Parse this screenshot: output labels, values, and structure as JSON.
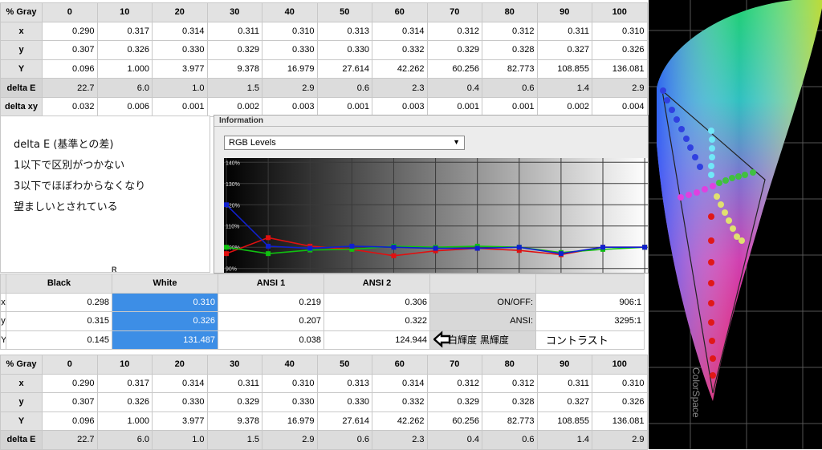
{
  "gray_table": {
    "header": [
      "% Gray",
      "0",
      "10",
      "20",
      "30",
      "40",
      "50",
      "60",
      "70",
      "80",
      "90",
      "100"
    ],
    "rows": [
      {
        "label": "x",
        "values": [
          "0.290",
          "0.317",
          "0.314",
          "0.311",
          "0.310",
          "0.313",
          "0.314",
          "0.312",
          "0.312",
          "0.311",
          "0.310"
        ]
      },
      {
        "label": "y",
        "values": [
          "0.307",
          "0.326",
          "0.330",
          "0.329",
          "0.330",
          "0.330",
          "0.332",
          "0.329",
          "0.328",
          "0.327",
          "0.326"
        ]
      },
      {
        "label": "Y",
        "values": [
          "0.096",
          "1.000",
          "3.977",
          "9.378",
          "16.979",
          "27.614",
          "42.262",
          "60.256",
          "82.773",
          "108.855",
          "136.081"
        ]
      },
      {
        "label": "delta E",
        "values": [
          "22.7",
          "6.0",
          "1.0",
          "1.5",
          "2.9",
          "0.6",
          "2.3",
          "0.4",
          "0.6",
          "1.4",
          "2.9"
        ]
      },
      {
        "label": "delta xy",
        "values": [
          "0.032",
          "0.006",
          "0.001",
          "0.002",
          "0.003",
          "0.001",
          "0.003",
          "0.001",
          "0.001",
          "0.002",
          "0.004"
        ]
      }
    ]
  },
  "note": {
    "lines": [
      "delta E (基準との差)",
      "1以下で区別がつかない",
      "3以下でほぼわからなくなり",
      "望ましいとされている"
    ],
    "fragment": "R"
  },
  "info": {
    "title": "Information",
    "select_value": "RGB Levels",
    "y_ticks": [
      "140%",
      "130%",
      "120%",
      "110%",
      "100%",
      "90%"
    ]
  },
  "chart_data": {
    "type": "line",
    "x": [
      "0",
      "10",
      "20",
      "30",
      "40",
      "50",
      "60",
      "70",
      "80",
      "90",
      "100"
    ],
    "ylim": [
      88,
      142
    ],
    "series": [
      {
        "name": "",
        "color": "#e01010",
        "values": [
          97,
          104.5,
          100.5,
          99,
          96,
          98.3,
          99.5,
          98.5,
          96.5,
          100,
          100
        ]
      },
      {
        "name": "",
        "color": "#10c010",
        "values": [
          100,
          97,
          98.7,
          99,
          100.5,
          100,
          100.5,
          100,
          97.5,
          99,
          100
        ]
      },
      {
        "name": "",
        "color": "#1020d0",
        "values": [
          120,
          100.5,
          99.5,
          100.5,
          100,
          99.5,
          99.5,
          100,
          97,
          100,
          100
        ]
      }
    ]
  },
  "contrast_table": {
    "header": [
      "",
      "Black",
      "White",
      "ANSI 1",
      "ANSI 2",
      "",
      ""
    ],
    "rows": [
      {
        "label": "x",
        "values": [
          "0.298",
          "0.310",
          "0.219",
          "0.306"
        ],
        "stat_label": "ON/OFF:",
        "stat_value": "906:1"
      },
      {
        "label": "y",
        "values": [
          "0.315",
          "0.326",
          "0.207",
          "0.322"
        ],
        "stat_label": "ANSI:",
        "stat_value": "3295:1"
      },
      {
        "label": "Y",
        "values": [
          "0.145",
          "131.487",
          "0.038",
          "124.944"
        ],
        "annotation": "白輝度 黒輝度",
        "annotation2": "コントラスト"
      }
    ]
  },
  "gamut": {
    "label": "ColorSpace"
  }
}
